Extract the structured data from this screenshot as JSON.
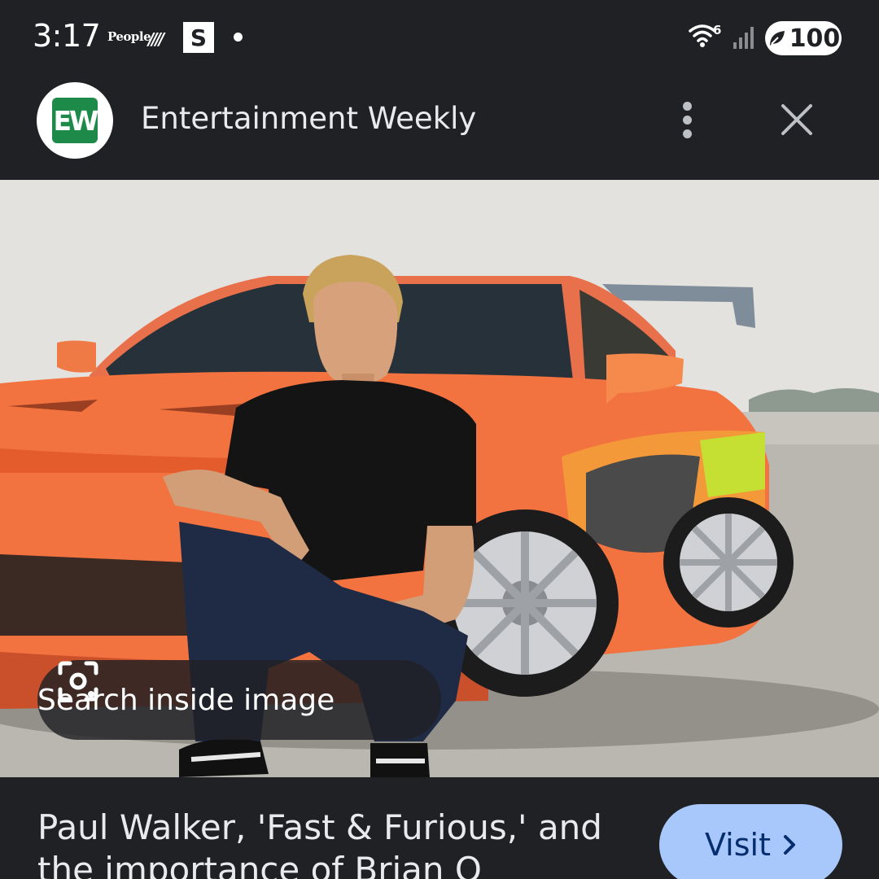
{
  "status_bar": {
    "time": "3:17",
    "notification_people": "People",
    "notification_s": "S",
    "wifi_badge": "6",
    "battery": "100"
  },
  "header": {
    "logo_text": "EW",
    "source_name": "Entertainment Weekly"
  },
  "image": {
    "search_label": "Search inside image"
  },
  "caption": {
    "title": "Paul Walker, 'Fast & Furious,' and the importance of Brian O",
    "visit_label": "Visit"
  },
  "icons": [
    "lens-icon",
    "more-vert-icon",
    "close-icon",
    "wifi-icon",
    "signal-icon",
    "battery-saver-icon",
    "chevron-right-icon"
  ]
}
